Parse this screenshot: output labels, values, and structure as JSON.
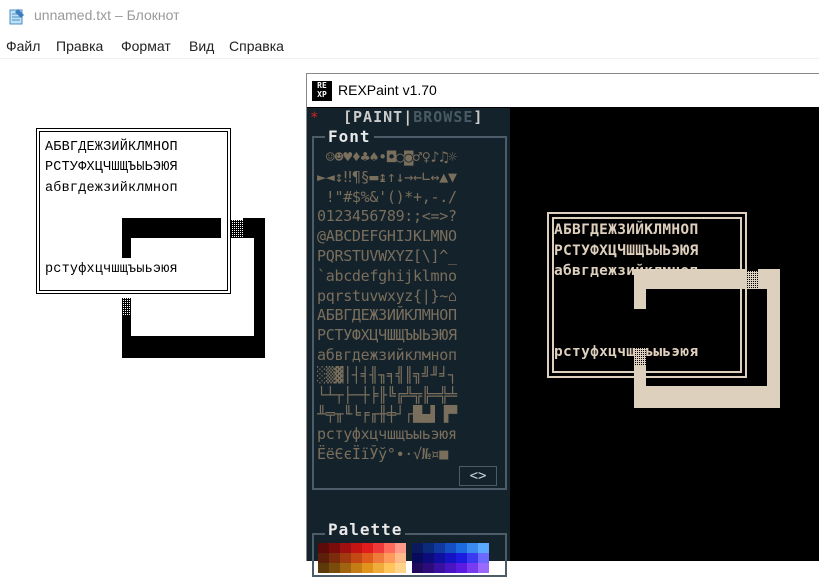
{
  "notepad": {
    "title": "unnamed.txt – Блокнот",
    "menu": [
      "Файл",
      "Правка",
      "Формат",
      "Вид",
      "Справка"
    ],
    "lines": [
      "АБВГДЕЖЗИЙКЛМНОП",
      "РСТУФХЦЧШЩЪЫЬЭЮЯ",
      "абвгдежзийклмноп",
      "рстуфхцчшщъыьэюя"
    ]
  },
  "rexpaint": {
    "title": "REXPaint v1.70",
    "logo_text": "RE XP",
    "tabs": {
      "open": "[",
      "paint": "PAINT",
      "sep": "|",
      "browse": "BROWSE",
      "close": "]"
    },
    "modified_marker": "*",
    "font_panel_title": "Font",
    "palette_panel_title": "Palette",
    "font_nav": "<>",
    "font_rows": [
      " ☺☻♥♦♣♠•◘○◙♂♀♪♫☼",
      "►◄↕‼¶§▬↨↑↓→←∟↔▲▼",
      " !\"#$%&'()*+,-./",
      "0123456789:;<=>?",
      "@ABCDEFGHIJKLMNO",
      "PQRSTUVWXYZ[\\]^_",
      "`abcdefghijklmno",
      "pqrstuvwxyz{|}~⌂",
      "АБВГДЕЖЗИЙКЛМНОП",
      "РСТУФХЦЧШЩЪЫЬЭЮЯ",
      "абвгдежзийклмноп",
      "░▒▓│┤╡╢╖╕╣║╗╝╜╛┐",
      "└┴┬├─┼╞╟╚╔╩╦╠═╬╧",
      "╨╤╥╙╘╒╓╫╪┘┌█▄▌▐▀",
      "рстуфхцчшщъыьэюя",
      "ЁёЄєЇїЎў°∙·√№¤■ "
    ],
    "canvas_lines": [
      "АБВГДЕЖЗИЙКЛМНОП",
      "РСТУФХЦЧШЩЪЫЬЭЮЯ",
      "абвгдежзийклмноп",
      "рстуфхцчшщъыьэюя"
    ],
    "palette_colors": [
      [
        "#5c0a0a",
        "#7a0c0c",
        "#a01010",
        "#c41414",
        "#e01c1c",
        "#f03a3a",
        "#ff6a5a",
        "#ff9a8a",
        "#0a1a5c",
        "#0c2a7a",
        "#103aa0",
        "#1450c4",
        "#1c6ae0",
        "#3a8af0",
        "#5aa8ff"
      ],
      [
        "#5c200a",
        "#7a2c0c",
        "#a03a10",
        "#c44814",
        "#e05c1c",
        "#f07a3a",
        "#ff9a5a",
        "#ffba8a",
        "#0a0a5c",
        "#0c0c7a",
        "#1010a0",
        "#1414c4",
        "#1c1ce0",
        "#3a3af0",
        "#6a6aff"
      ],
      [
        "#5c3a0a",
        "#7a4c0c",
        "#a06410",
        "#c47c14",
        "#e0941c",
        "#f0ac3a",
        "#ffc45a",
        "#ffd48a",
        "#200a5c",
        "#2c0c7a",
        "#3a10a0",
        "#4814c4",
        "#5c1ce0",
        "#7a3af0",
        "#9a6aff"
      ]
    ]
  }
}
